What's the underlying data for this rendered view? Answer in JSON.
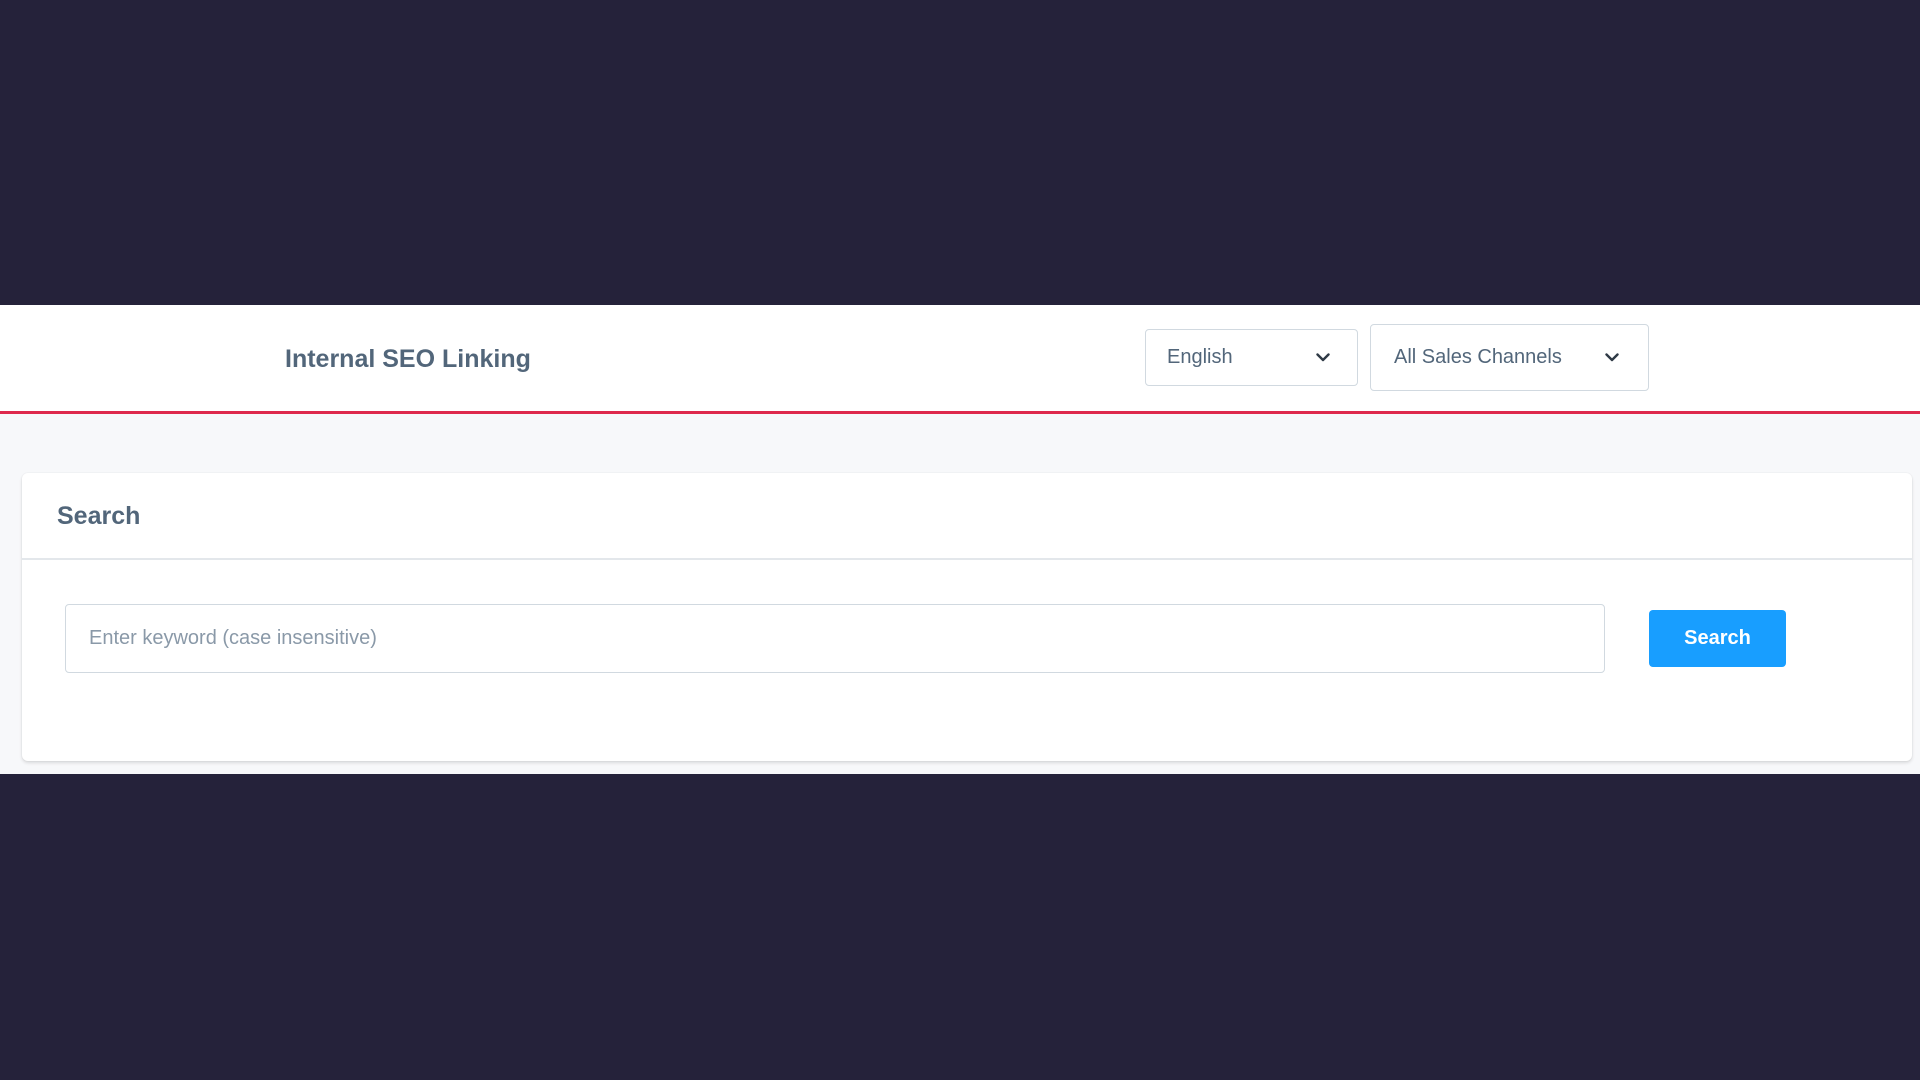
{
  "header": {
    "title": "Internal SEO Linking",
    "language_select": {
      "value": "English",
      "icon": "chevron-down-icon"
    },
    "sales_channel_select": {
      "value": "All Sales Channels",
      "icon": "chevron-down-icon"
    },
    "accent_color": "#de294c"
  },
  "search_card": {
    "title": "Search",
    "input": {
      "value": "",
      "placeholder": "Enter keyword (case insensitive)"
    },
    "button_label": "Search",
    "button_color": "#189eff"
  }
}
